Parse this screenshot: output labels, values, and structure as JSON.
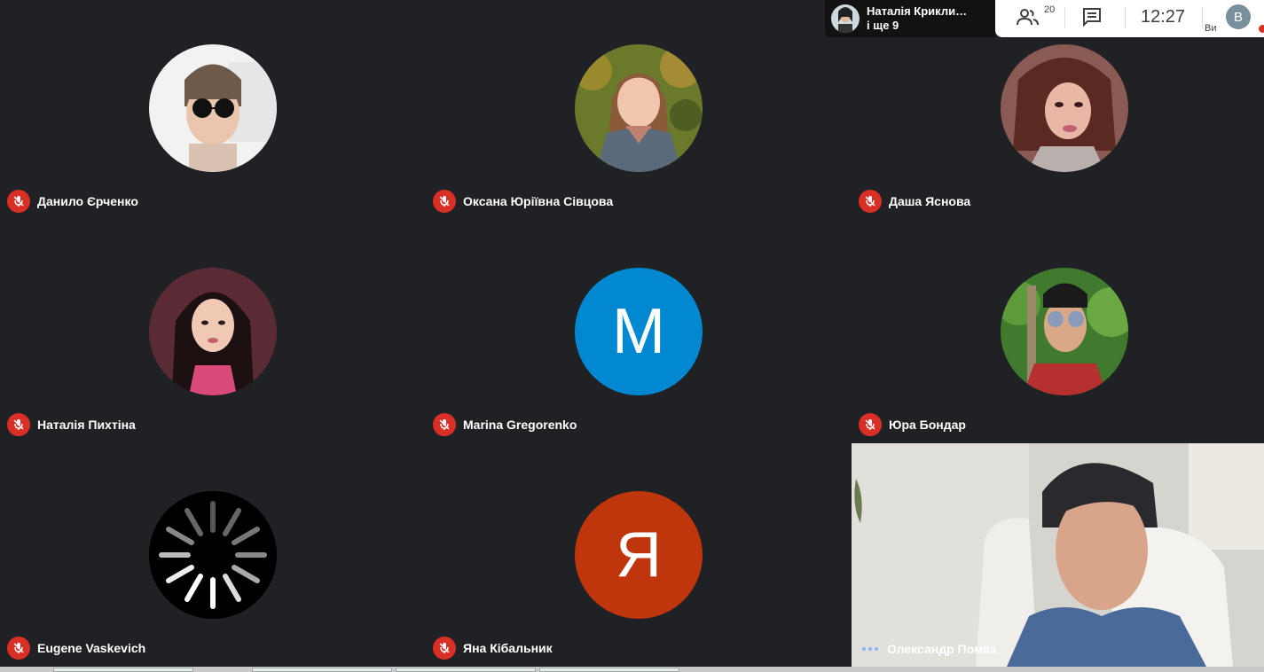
{
  "header": {
    "presenter_name": "Наталія Крикли…",
    "presenter_more": "і ще 9",
    "participants_count": "20",
    "time": "12:27",
    "user_initial": "B",
    "you_label": "Ви"
  },
  "participants": [
    {
      "name": "Данило Єрченко",
      "avatar": "photo"
    },
    {
      "name": "Оксана Юріївна Сівцова",
      "avatar": "photo"
    },
    {
      "name": "Даша Яснова",
      "avatar": "photo"
    },
    {
      "name": "Наталія Пихтіна",
      "avatar": "photo"
    },
    {
      "name": "Marina Gregorenko",
      "avatar": "letter",
      "letter": "M",
      "color": "#0288d1"
    },
    {
      "name": "Юра Бондар",
      "avatar": "photo"
    },
    {
      "name": "Eugene Vaskevich",
      "avatar": "loading-spinner"
    },
    {
      "name": "Яна Кібальник",
      "avatar": "letter",
      "letter": "Я",
      "color": "#bf360c"
    }
  ],
  "featured": {
    "name": "Олександр Помаз"
  },
  "colors": {
    "background": "#202124",
    "mic_muted": "#d93025",
    "speaking_dots": "#8ab4f8"
  }
}
